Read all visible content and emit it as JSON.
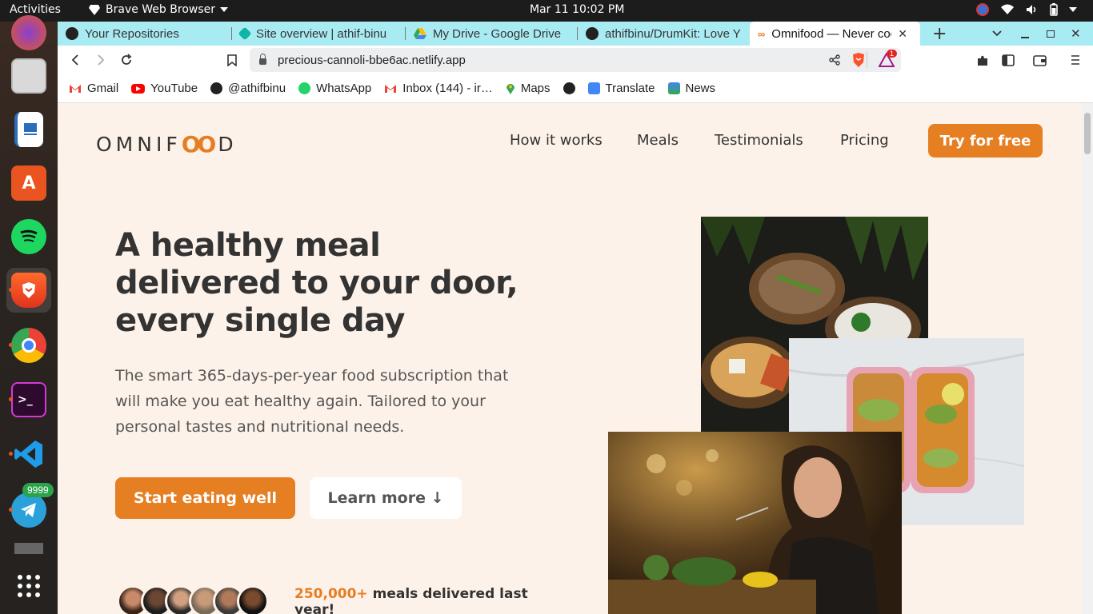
{
  "system": {
    "activities": "Activities",
    "app_name": "Brave Web Browser",
    "clock": "Mar 11  10:02 PM"
  },
  "dock": {
    "telegram_badge": "9999"
  },
  "tabs": [
    {
      "label": "Your Repositories",
      "icon": "github-icon"
    },
    {
      "label": "Site overview | athif-binu",
      "icon": "netlify-icon"
    },
    {
      "label": "My Drive - Google Drive",
      "icon": "google-drive-icon"
    },
    {
      "label": "athifbinu/DrumKit: Love Y",
      "icon": "github-icon"
    },
    {
      "label": "Omnifood — Never coo",
      "icon": "omnifood-icon"
    }
  ],
  "url": "precious-cannoli-bbe6ac.netlify.app",
  "shields_badge": "1",
  "bookmarks": [
    {
      "label": "Gmail",
      "icon": "gmail-icon",
      "color": "#ea4335"
    },
    {
      "label": "YouTube",
      "icon": "youtube-icon",
      "color": "#ff0000"
    },
    {
      "label": "@athifbinu",
      "icon": "globe-icon",
      "color": "#222222"
    },
    {
      "label": "WhatsApp",
      "icon": "whatsapp-icon",
      "color": "#25d366"
    },
    {
      "label": "Inbox (144) - ir…",
      "icon": "gmail-icon",
      "color": "#ea4335"
    },
    {
      "label": "Maps",
      "icon": "maps-icon",
      "color": "#34a853"
    },
    {
      "label": "",
      "icon": "globe-icon",
      "color": "#222222"
    },
    {
      "label": "Translate",
      "icon": "translate-icon",
      "color": "#4285f4"
    },
    {
      "label": "News",
      "icon": "news-icon",
      "color": "#4285f4"
    }
  ],
  "site": {
    "logo": "OMNIFOOD",
    "nav": [
      "How it works",
      "Meals",
      "Testimonials",
      "Pricing"
    ],
    "cta": "Try for free",
    "hero_title": "A healthy meal delivered to your door, every single day",
    "hero_description": "The smart 365-days-per-year food subscription that will make you eat healthy again. Tailored to your personal tastes and nutritional needs.",
    "primary_button": "Start eating well",
    "secondary_button": "Learn more ↓",
    "delivered_count": "250,000+",
    "delivered_text": "meals delivered last year!",
    "accent_color": "#e67e22",
    "background_color": "#fdf2e9"
  }
}
